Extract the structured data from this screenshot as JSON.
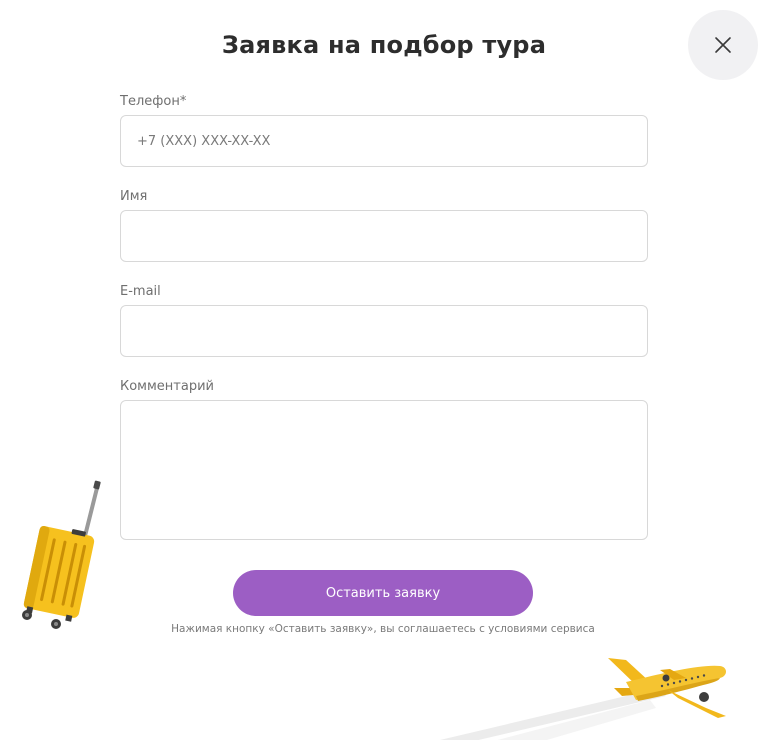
{
  "form": {
    "title": "Заявка на подбор тура",
    "close_icon": "close-icon",
    "phone": {
      "label": "Телефон*",
      "placeholder": "+7 (XXX) XXX-XX-XX",
      "value": ""
    },
    "name": {
      "label": "Имя",
      "placeholder": "",
      "value": ""
    },
    "email": {
      "label": "E-mail",
      "placeholder": "",
      "value": ""
    },
    "comment": {
      "label": "Комментарий",
      "placeholder": "",
      "value": ""
    },
    "submit_label": "Оставить заявку",
    "agreement_text": "Нажимая кнопку «Оставить заявку», вы соглашаетесь с условиями сервиса"
  },
  "decorations": {
    "suitcase_icon": "suitcase-illustration",
    "plane_icon": "airplane-illustration"
  },
  "colors": {
    "accent": "#9c5ec4",
    "suitcase": "#f6c11e",
    "plane": "#f5c431",
    "close_bg": "#f1f1f3",
    "border": "#d8d8d8"
  }
}
